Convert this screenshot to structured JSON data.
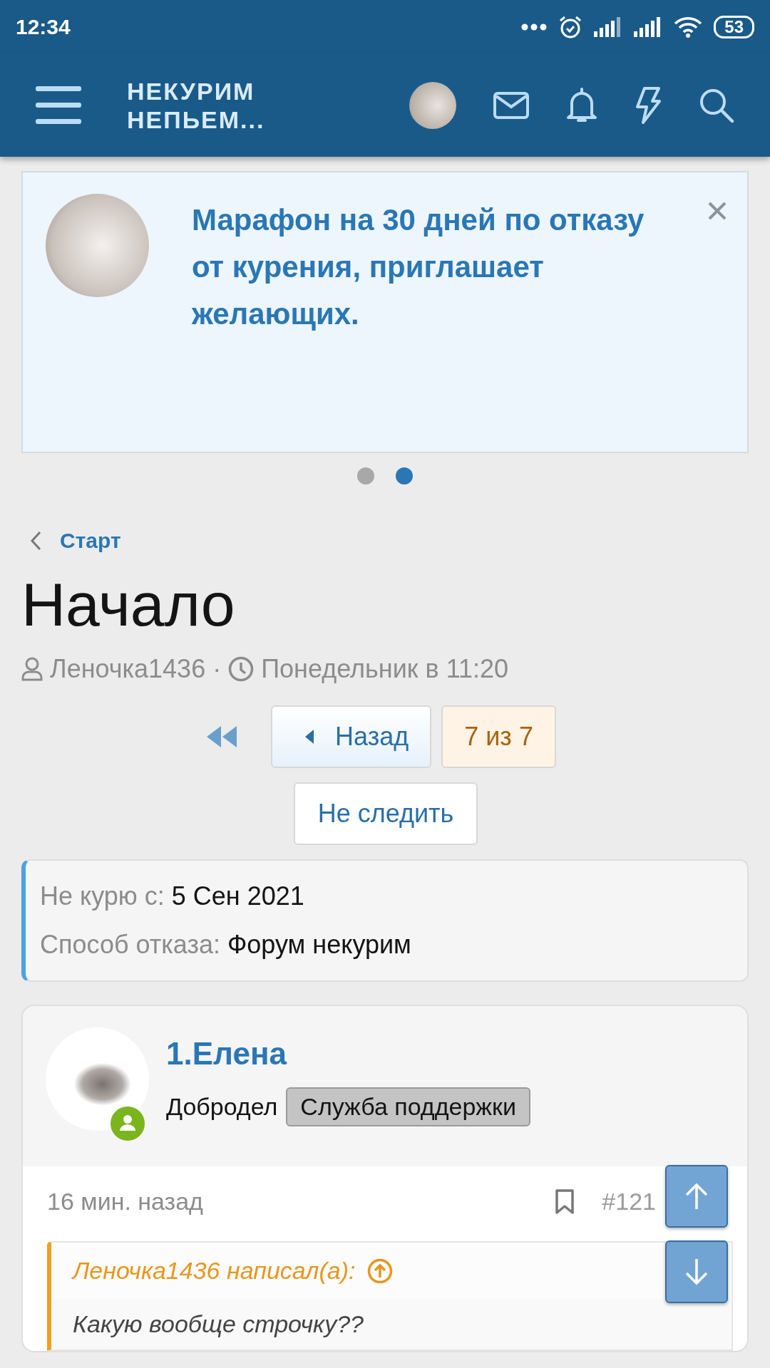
{
  "status_bar": {
    "time": "12:34",
    "battery": "53"
  },
  "header": {
    "logo_lines": [
      "НЕКУРИМ",
      "НЕПЬЕМ..."
    ]
  },
  "notice": {
    "text": "Марафон на 30 дней по отказу от курения, приглашает желающих.",
    "pages": [
      {
        "selected": false
      },
      {
        "selected": true
      }
    ]
  },
  "breadcrumb": "Старт",
  "title": "Начало",
  "meta": {
    "author": "Леночка1436",
    "separator": "·",
    "date": "Понедельник в 11:20"
  },
  "pagination": {
    "prev": "Назад",
    "current": "7 из 7"
  },
  "watch_button": "Не следить",
  "info": [
    {
      "label": "Не курю с:",
      "value": "5 Сен 2021"
    },
    {
      "label": "Способ отказа:",
      "value": "Форум некурим"
    }
  ],
  "post": {
    "author": "1.Елена",
    "user_title": "Добродел",
    "badge": "Служба поддержки",
    "online": true,
    "time": "16 мин. назад",
    "number": "#121",
    "quote": {
      "author": "Леночка1436 написал(а):",
      "text": "Какую вообще строчку??"
    }
  }
}
